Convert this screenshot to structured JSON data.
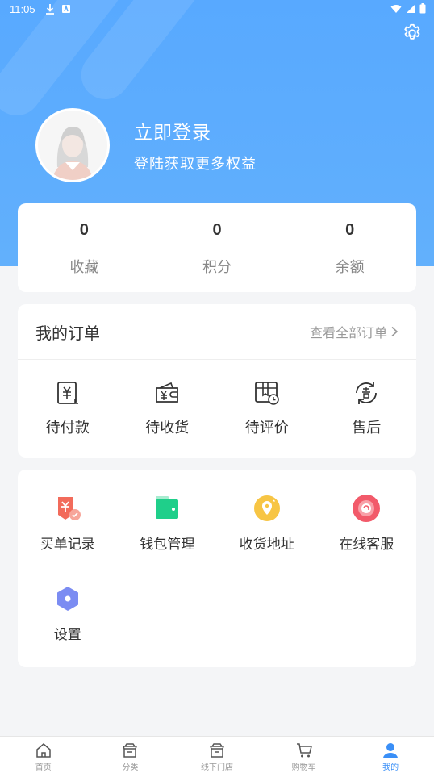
{
  "status_bar": {
    "time": "11:05"
  },
  "header": {
    "login_title": "立即登录",
    "login_subtitle": "登陆获取更多权益"
  },
  "stats": [
    {
      "value": "0",
      "label": "收藏"
    },
    {
      "value": "0",
      "label": "积分"
    },
    {
      "value": "0",
      "label": "余额"
    }
  ],
  "orders": {
    "title": "我的订单",
    "view_all": "查看全部订单",
    "items": [
      {
        "label": "待付款",
        "icon": "pending-payment-icon"
      },
      {
        "label": "待收货",
        "icon": "pending-receipt-icon"
      },
      {
        "label": "待评价",
        "icon": "pending-review-icon"
      },
      {
        "label": "售后",
        "icon": "after-sales-icon"
      }
    ]
  },
  "tools": {
    "items": [
      {
        "label": "买单记录",
        "icon": "bill-record-icon"
      },
      {
        "label": "钱包管理",
        "icon": "wallet-icon"
      },
      {
        "label": "收货地址",
        "icon": "location-icon"
      },
      {
        "label": "在线客服",
        "icon": "customer-service-icon"
      },
      {
        "label": "设置",
        "icon": "settings-hexagon-icon"
      }
    ]
  },
  "tabbar": [
    {
      "label": "首页",
      "icon": "home-icon"
    },
    {
      "label": "分类",
      "icon": "category-icon"
    },
    {
      "label": "线下门店",
      "icon": "store-icon"
    },
    {
      "label": "购物车",
      "icon": "cart-icon"
    },
    {
      "label": "我的",
      "icon": "user-icon",
      "active": true
    }
  ],
  "colors": {
    "header_blue": "#58a9ff",
    "active_tab": "#3a8ff7",
    "wallet_green": "#1fcf8a",
    "location_yellow": "#f7c544",
    "service_red": "#f25a6a",
    "settings_purple": "#7b8cf2",
    "bill_red": "#f26b5b"
  }
}
